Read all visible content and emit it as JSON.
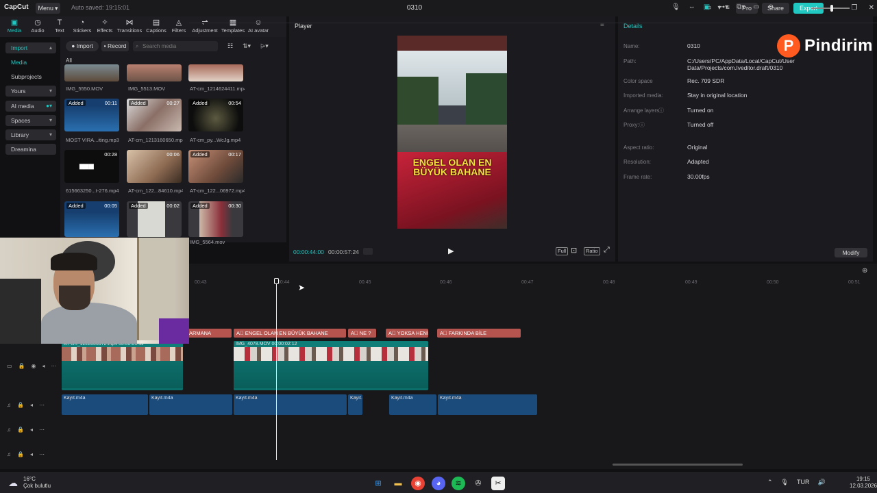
{
  "titlebar": {
    "logo": "CapCut",
    "menu": "Menu",
    "autosave": "Auto saved: 19:15:01",
    "project": "0310",
    "pro": "Pro",
    "share": "Share",
    "export": "Export"
  },
  "toolbar": [
    "Media",
    "Audio",
    "Text",
    "Stickers",
    "Effects",
    "Transitions",
    "Captions",
    "Filters",
    "Adjustment",
    "Templates",
    "AI avatar"
  ],
  "media_sidebar": [
    {
      "label": "Import"
    },
    {
      "label": "Media"
    },
    {
      "label": "Subprojects"
    },
    {
      "label": "Yours"
    },
    {
      "label": "AI media"
    },
    {
      "label": "Spaces"
    },
    {
      "label": "Library"
    },
    {
      "label": "Dreamina"
    }
  ],
  "media_panel": {
    "import": "Import",
    "record": "Record",
    "search_placeholder": "Search media",
    "all": "All",
    "items": [
      {
        "name": "IMG_5550.MOV",
        "badge": "",
        "dur": ""
      },
      {
        "name": "IMG_5513.MOV",
        "badge": "",
        "dur": ""
      },
      {
        "name": "AT-cm_1214624411.mp4",
        "badge": "",
        "dur": ""
      },
      {
        "name": "MOST VIRA...iting.mp3",
        "badge": "Added",
        "dur": "00:11"
      },
      {
        "name": "AT-cm_1213160650.mp4",
        "badge": "Added",
        "dur": "00:27"
      },
      {
        "name": "AT-cm_py...WcJg.mp4",
        "badge": "Added",
        "dur": "00:54"
      },
      {
        "name": "615663250...t-276.mp4",
        "badge": "",
        "dur": "00:28"
      },
      {
        "name": "AT-cm_122...84610.mp4",
        "badge": "",
        "dur": "00:06"
      },
      {
        "name": "AT-cm_122...06972.mp4",
        "badge": "Added",
        "dur": "00:17"
      },
      {
        "name": "",
        "badge": "Added",
        "dur": "00:05"
      },
      {
        "name": "",
        "badge": "Added",
        "dur": "00:02"
      },
      {
        "name": "IMG_5564.mov",
        "badge": "Added",
        "dur": "00:30"
      }
    ]
  },
  "player": {
    "title": "Player",
    "caption_line1": "ENGEL OLAN EN",
    "caption_line2": "BÜYÜK BAHANE",
    "current": "00:00:44:00",
    "total": "00:00:57:24",
    "full": "Full",
    "ratio": "Ratio"
  },
  "details": {
    "title": "Details",
    "rows": [
      {
        "k": "Name:",
        "v": "0310"
      },
      {
        "k": "Path:",
        "v": "C:/Users/PC/AppData/Local/CapCut/User Data/Projects/com.lveditor.draft/0310"
      },
      {
        "k": "Color space",
        "v": "Rec. 709 SDR"
      },
      {
        "k": "Imported media:",
        "v": "Stay in original location"
      },
      {
        "k": "Arrange layers",
        "v": "Turned on"
      },
      {
        "k": "Proxy:",
        "v": "Turned off"
      },
      {
        "k": "Aspect ratio:",
        "v": "Original"
      },
      {
        "k": "Resolution:",
        "v": "Adapted"
      },
      {
        "k": "Frame rate:",
        "v": "30.00fps"
      }
    ],
    "modify": "Modify"
  },
  "watermark": {
    "logo": "P",
    "text": "Pindirim"
  },
  "timeline": {
    "ticks": [
      "00:43",
      "00:44",
      "00:45",
      "00:46",
      "00:47",
      "00:48",
      "00:49",
      "00:50",
      "00:51"
    ],
    "text_clips": [
      "ARMANA",
      "ENGEL OLAN EN BÜYÜK BAHANE",
      "NE ?",
      "YOKSA HENÜZ",
      "FARKINDA BİLE"
    ],
    "video_clips": [
      {
        "label": "AT-cm_1222806972.mp4  00:00:01:11"
      },
      {
        "label": "IMG_4078.MOV  00:00:02:12"
      }
    ],
    "audio_clips": [
      "Kayıt.m4a",
      "Kayıt.m4a",
      "Kayıt.m4a",
      "Kayıt.m",
      "Kayıt.m4a",
      "Kayıt.m4a"
    ]
  },
  "taskbar": {
    "temp": "16°C",
    "weather": "Çok bulutlu",
    "lang": "TUR",
    "time": "19:15",
    "date": "12.03.2026"
  }
}
